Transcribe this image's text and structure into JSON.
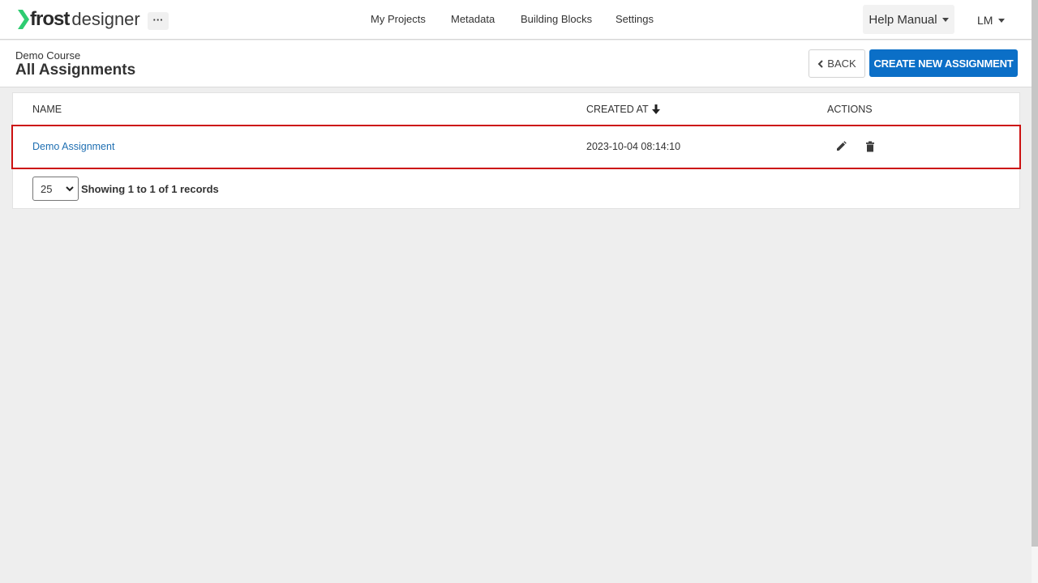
{
  "app": {
    "logo_bold": "frost",
    "logo_light": "designer",
    "more_label": "···"
  },
  "nav": {
    "items": [
      {
        "label": "My Projects"
      },
      {
        "label": "Metadata"
      },
      {
        "label": "Building Blocks"
      },
      {
        "label": "Settings"
      }
    ],
    "help_label": "Help Manual",
    "user_initials": "LM"
  },
  "header": {
    "breadcrumb": "Demo Course",
    "title": "All Assignments",
    "back_label": "BACK",
    "create_label": "CREATE NEW ASSIGNMENT"
  },
  "table": {
    "columns": [
      "NAME",
      "CREATED AT",
      "ACTIONS"
    ],
    "sort_column": "CREATED AT",
    "sort_direction": "descending",
    "rows": [
      {
        "name": "Demo Assignment",
        "created_at": "2023-10-04 08:14:10"
      }
    ]
  },
  "pagination": {
    "page_size": "25",
    "info": "Showing 1 to 1 of 1 records"
  },
  "colors": {
    "accent": "#0b6fc7",
    "link": "#1f6fb2",
    "highlight_border": "#cc1111",
    "logo_green": "#2ecc71"
  }
}
